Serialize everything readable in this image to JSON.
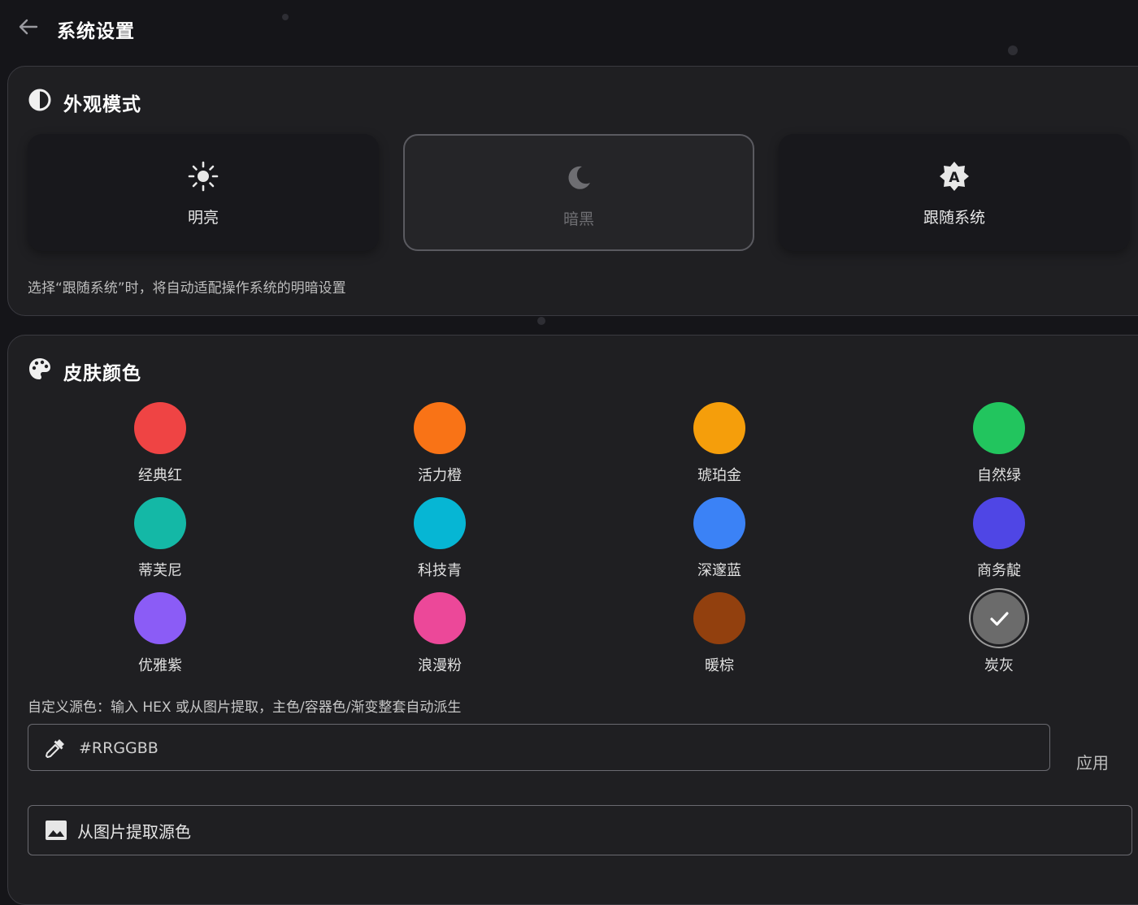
{
  "header": {
    "title": "系统设置",
    "back_icon": "arrow-left-icon"
  },
  "appearance": {
    "title": "外观模式",
    "icon": "contrast-icon",
    "modes": [
      {
        "label": "明亮",
        "icon": "sun-icon",
        "selected": false
      },
      {
        "label": "暗黑",
        "icon": "moon-icon",
        "selected": true
      },
      {
        "label": "跟随系统",
        "icon": "brightness-auto-icon",
        "selected": false
      }
    ],
    "hint": "选择“跟随系统”时，将自动适配操作系统的明暗设置"
  },
  "skin": {
    "title": "皮肤颜色",
    "icon": "palette-icon",
    "colors": [
      {
        "name": "经典红",
        "color": "#ef4444",
        "selected": false
      },
      {
        "name": "活力橙",
        "color": "#f97316",
        "selected": false
      },
      {
        "name": "琥珀金",
        "color": "#f59e0b",
        "selected": false
      },
      {
        "name": "自然绿",
        "color": "#22c55e",
        "selected": false
      },
      {
        "name": "蒂芙尼",
        "color": "#14b8a6",
        "selected": false
      },
      {
        "name": "科技青",
        "color": "#06b6d4",
        "selected": false
      },
      {
        "name": "深邃蓝",
        "color": "#3b82f6",
        "selected": false
      },
      {
        "name": "商务靛",
        "color": "#4f46e5",
        "selected": false
      },
      {
        "name": "优雅紫",
        "color": "#8b5cf6",
        "selected": false
      },
      {
        "name": "浪漫粉",
        "color": "#ec4899",
        "selected": false
      },
      {
        "name": "暖棕",
        "color": "#92400e",
        "selected": false
      },
      {
        "name": "炭灰",
        "color": "#6b6b6b",
        "selected": true
      }
    ],
    "custom_hint": "自定义源色：输入 HEX 或从图片提取，主色/容器色/渐变整套自动派生",
    "hex_placeholder": "#RRGGBB",
    "hex_icon": "eyedropper-icon",
    "apply_label": "应用",
    "image_button_label": "从图片提取源色",
    "image_icon": "image-icon"
  }
}
